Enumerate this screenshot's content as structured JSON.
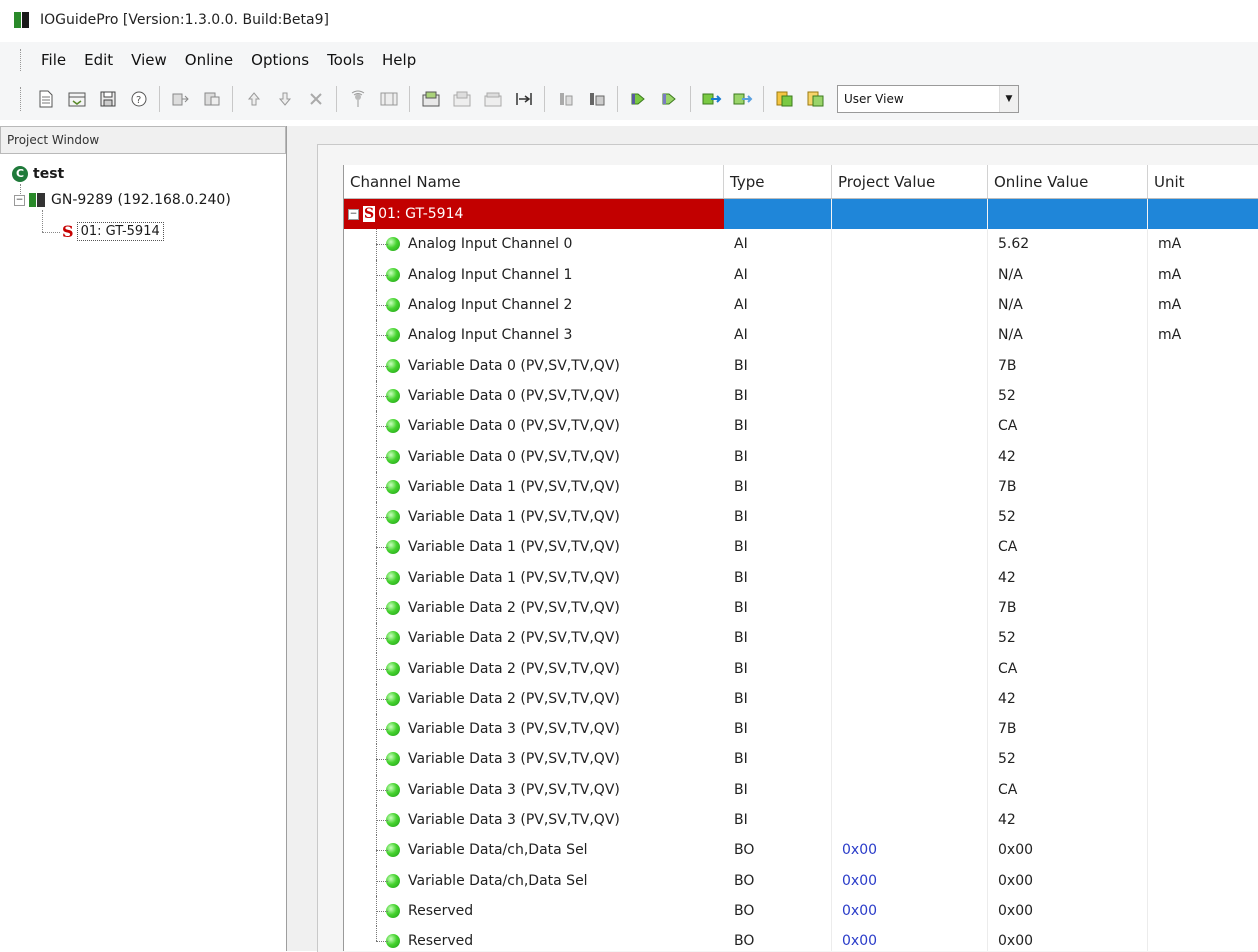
{
  "window": {
    "title": "IOGuidePro  [Version:1.3.0.0. Build:Beta9]"
  },
  "menu": [
    "File",
    "Edit",
    "View",
    "Online",
    "Options",
    "Tools",
    "Help"
  ],
  "toolbar": {
    "view_select": "User View",
    "buttons": [
      "new-icon",
      "open-icon",
      "save-icon",
      "help-icon",
      "copy-icon",
      "paste-icon",
      "move-up-icon",
      "move-down-icon",
      "delete-icon",
      "scan-icon",
      "io-map-icon",
      "download-icon",
      "upload-icon",
      "upload-all-icon",
      "compare-icon",
      "export-icon",
      "connect-icon",
      "disconnect-icon",
      "send-icon",
      "receive-icon",
      "import-icon",
      "report-icon"
    ]
  },
  "project_window": {
    "header": "Project Window",
    "root": "test",
    "device": "GN-9289 (192.168.0.240)",
    "module": "01: GT-5914"
  },
  "grid": {
    "columns": [
      "Channel Name",
      "Type",
      "Project Value",
      "Online Value",
      "Unit"
    ],
    "group_label": "01: GT-5914",
    "rows": [
      {
        "name": "Analog Input Channel 0",
        "type": "AI",
        "project": "",
        "online": "5.62",
        "unit": "mA"
      },
      {
        "name": "Analog Input Channel 1",
        "type": "AI",
        "project": "",
        "online": "N/A",
        "unit": "mA"
      },
      {
        "name": "Analog Input Channel 2",
        "type": "AI",
        "project": "",
        "online": "N/A",
        "unit": "mA"
      },
      {
        "name": "Analog Input Channel 3",
        "type": "AI",
        "project": "",
        "online": "N/A",
        "unit": "mA"
      },
      {
        "name": "Variable Data 0 (PV,SV,TV,QV)",
        "type": "BI",
        "project": "",
        "online": "7B",
        "unit": ""
      },
      {
        "name": "Variable Data 0 (PV,SV,TV,QV)",
        "type": "BI",
        "project": "",
        "online": "52",
        "unit": ""
      },
      {
        "name": "Variable Data 0 (PV,SV,TV,QV)",
        "type": "BI",
        "project": "",
        "online": "CA",
        "unit": ""
      },
      {
        "name": "Variable Data 0 (PV,SV,TV,QV)",
        "type": "BI",
        "project": "",
        "online": "42",
        "unit": ""
      },
      {
        "name": "Variable Data 1 (PV,SV,TV,QV)",
        "type": "BI",
        "project": "",
        "online": "7B",
        "unit": ""
      },
      {
        "name": "Variable Data 1 (PV,SV,TV,QV)",
        "type": "BI",
        "project": "",
        "online": "52",
        "unit": ""
      },
      {
        "name": "Variable Data 1 (PV,SV,TV,QV)",
        "type": "BI",
        "project": "",
        "online": "CA",
        "unit": ""
      },
      {
        "name": "Variable Data 1 (PV,SV,TV,QV)",
        "type": "BI",
        "project": "",
        "online": "42",
        "unit": ""
      },
      {
        "name": "Variable Data 2 (PV,SV,TV,QV)",
        "type": "BI",
        "project": "",
        "online": "7B",
        "unit": ""
      },
      {
        "name": "Variable Data 2 (PV,SV,TV,QV)",
        "type": "BI",
        "project": "",
        "online": "52",
        "unit": ""
      },
      {
        "name": "Variable Data 2 (PV,SV,TV,QV)",
        "type": "BI",
        "project": "",
        "online": "CA",
        "unit": ""
      },
      {
        "name": "Variable Data 2 (PV,SV,TV,QV)",
        "type": "BI",
        "project": "",
        "online": "42",
        "unit": ""
      },
      {
        "name": "Variable Data 3 (PV,SV,TV,QV)",
        "type": "BI",
        "project": "",
        "online": "7B",
        "unit": ""
      },
      {
        "name": "Variable Data 3 (PV,SV,TV,QV)",
        "type": "BI",
        "project": "",
        "online": "52",
        "unit": ""
      },
      {
        "name": "Variable Data 3 (PV,SV,TV,QV)",
        "type": "BI",
        "project": "",
        "online": "CA",
        "unit": ""
      },
      {
        "name": "Variable Data 3 (PV,SV,TV,QV)",
        "type": "BI",
        "project": "",
        "online": "42",
        "unit": ""
      },
      {
        "name": "Variable Data/ch,Data Sel",
        "type": "BO",
        "project": "0x00",
        "online": "0x00",
        "unit": ""
      },
      {
        "name": "Variable Data/ch,Data Sel",
        "type": "BO",
        "project": "0x00",
        "online": "0x00",
        "unit": ""
      },
      {
        "name": "Reserved",
        "type": "BO",
        "project": "0x00",
        "online": "0x00",
        "unit": ""
      },
      {
        "name": "Reserved",
        "type": "BO",
        "project": "0x00",
        "online": "0x00",
        "unit": ""
      }
    ]
  }
}
